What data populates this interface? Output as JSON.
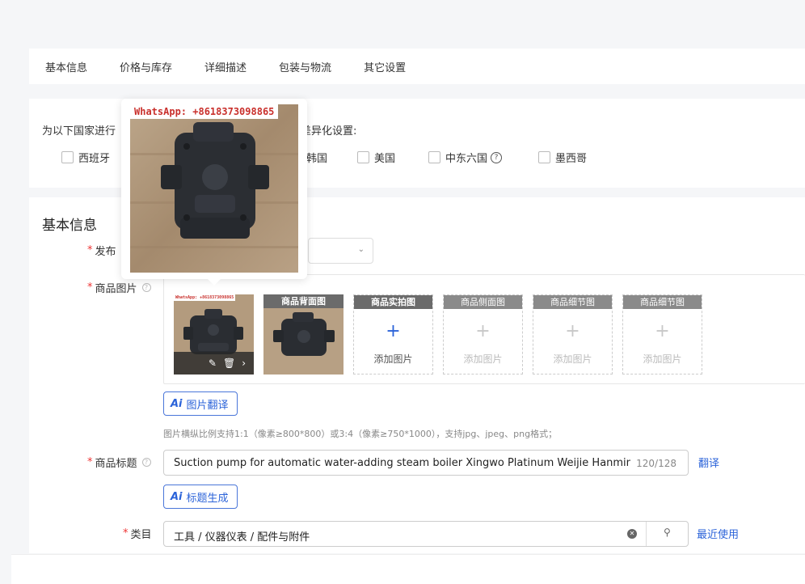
{
  "tabs": [
    "基本信息",
    "价格与库存",
    "详细描述",
    "包装与物流",
    "其它设置"
  ],
  "country_section": {
    "prompt_left": "为以下国家进行",
    "prompt_right": "差异化设置:",
    "countries": [
      {
        "label": "西班牙",
        "checked": false
      },
      {
        "label": "韩国",
        "checked": false
      },
      {
        "label": "美国",
        "checked": false
      },
      {
        "label": "中东六国",
        "checked": false,
        "help": "?"
      },
      {
        "label": "墨西哥",
        "checked": false
      }
    ]
  },
  "basic": {
    "title": "基本信息",
    "publish_label": "发布",
    "images_label": "商品图片",
    "image_slots": [
      {
        "header": "",
        "filled": true
      },
      {
        "header": "商品背面图",
        "filled": true
      },
      {
        "header": "商品实拍图",
        "filled": false,
        "add_text": "添加图片",
        "active": true
      },
      {
        "header": "商品侧面图",
        "filled": false,
        "add_text": "添加图片"
      },
      {
        "header": "商品细节图",
        "filled": false,
        "add_text": "添加图片"
      },
      {
        "header": "商品细节图",
        "filled": false,
        "add_text": "添加图片"
      }
    ],
    "img_translate_btn": "图片翻译",
    "image_hint": "图片横纵比例支持1:1（像素≥800*800）或3:4（像素≥750*1000），支持jpg、jpeg、png格式；",
    "title_label": "商品标题",
    "title_value": "Suction pump for automatic water-adding steam boiler Xingwo Platinum Weijie Hanmingwe",
    "title_count": "120/128",
    "translate_link": "翻译",
    "title_gen_btn": "标题生成",
    "category_label": "类目",
    "category_value": "工具 / 仪器仪表 / 配件与附件",
    "recent_link": "最近使用",
    "ai_mark": "Ai"
  },
  "watermark": "WhatsApp: +8618373098865",
  "colors": {
    "accent": "#2b63d9",
    "required": "#e33333",
    "watermark": "#c9302c"
  }
}
